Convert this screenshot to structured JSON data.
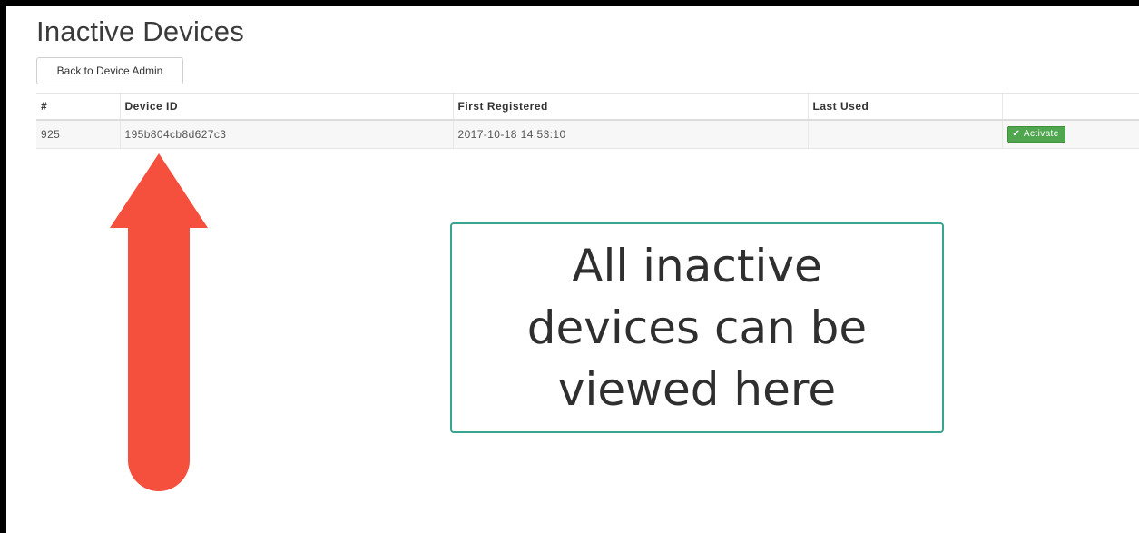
{
  "page": {
    "title": "Inactive Devices",
    "back_button_label": "Back to Device Admin"
  },
  "table": {
    "headers": [
      "#",
      "Device ID",
      "First Registered",
      "Last Used",
      ""
    ],
    "rows": [
      {
        "number": "925",
        "device_id": "195b804cb8d627c3",
        "first_registered": "2017-10-18 14:53:10",
        "last_used": "",
        "action_label": "Activate",
        "action_icon": "check-icon"
      }
    ]
  },
  "annotation": {
    "callout_text": "All inactive\ndevices can be\nviewed here",
    "arrow_color": "#f54f3e",
    "callout_border_color": "#3aa58f"
  },
  "colors": {
    "activate_button": "#4fa64f"
  }
}
